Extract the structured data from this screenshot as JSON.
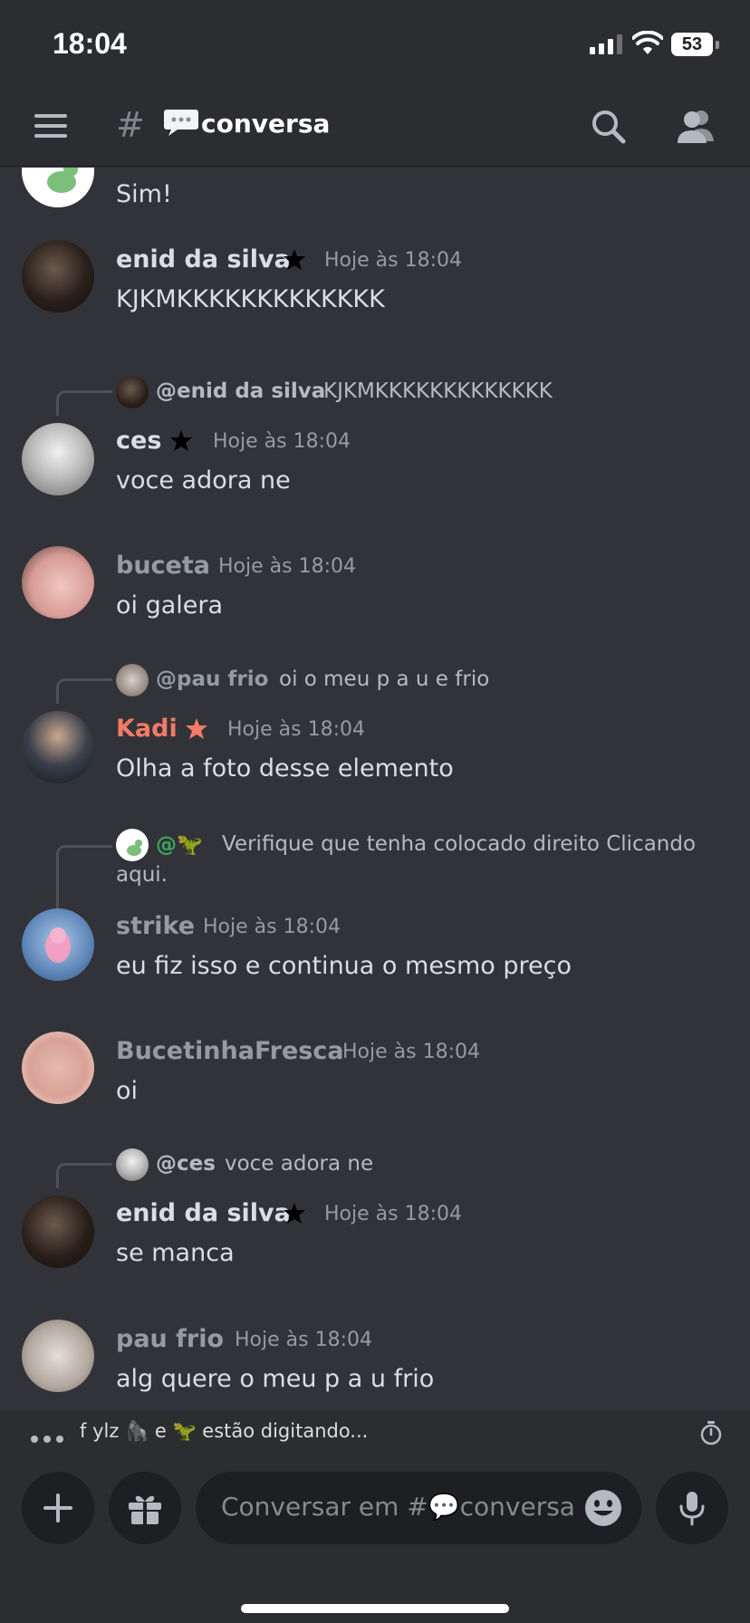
{
  "status_bar": {
    "time": "18:04",
    "battery": "53"
  },
  "header": {
    "channel_hash": "#",
    "channel_name": "conversa"
  },
  "messages": [
    {
      "content": "Sim!"
    },
    {
      "username": "enid da silva",
      "timestamp": "Hoje às 18:04",
      "content": "KJKMKKKKKKKKKKKKK"
    },
    {
      "reply_mention": "@enid da silva",
      "reply_text": "KJKMKKKKKKKKKKKKK",
      "username": "ces",
      "timestamp": "Hoje às 18:04",
      "content": "voce adora ne"
    },
    {
      "username": "buceta",
      "timestamp": "Hoje às 18:04",
      "content": "oi galera"
    },
    {
      "reply_mention": "@pau  frio",
      "reply_text": "oi o meu p a u  e frio",
      "username": "Kadi",
      "timestamp": "Hoje às 18:04",
      "content": "Olha a foto desse elemento"
    },
    {
      "reply_mention": "@🦖",
      "reply_text": "Verifique que tenha colocado direito Clicando",
      "reply_text_2": "aqui.",
      "username": "strike",
      "timestamp": "Hoje às 18:04",
      "content": "eu fiz isso e continua o mesmo preço"
    },
    {
      "username": "BucetinhaFresca",
      "timestamp": "Hoje às 18:04",
      "content": "oi"
    },
    {
      "reply_mention": "@ces",
      "reply_text": "voce adora ne",
      "username": "enid da silva",
      "timestamp": "Hoje às 18:04",
      "content": "se manca"
    },
    {
      "username": "pau  frio",
      "timestamp": "Hoje às 18:04",
      "content": "alg quere o meu p a u frio"
    }
  ],
  "typing": {
    "text": "f ylz 🦍 e 🦖 estão digitando..."
  },
  "composer": {
    "placeholder": "Conversar em #💬conversa"
  },
  "colors": {
    "background": "#313338",
    "header": "#2b2d31",
    "username_default": "#dbdee1",
    "username_muted": "#949ba4",
    "username_kadi": "#f47b67",
    "timestamp": "#949ba4"
  },
  "icons": [
    "hamburger-icon",
    "search-icon",
    "members-icon",
    "plus-icon",
    "gift-icon",
    "emoji-icon",
    "mic-icon",
    "timer-icon",
    "crown-badge-icon"
  ]
}
